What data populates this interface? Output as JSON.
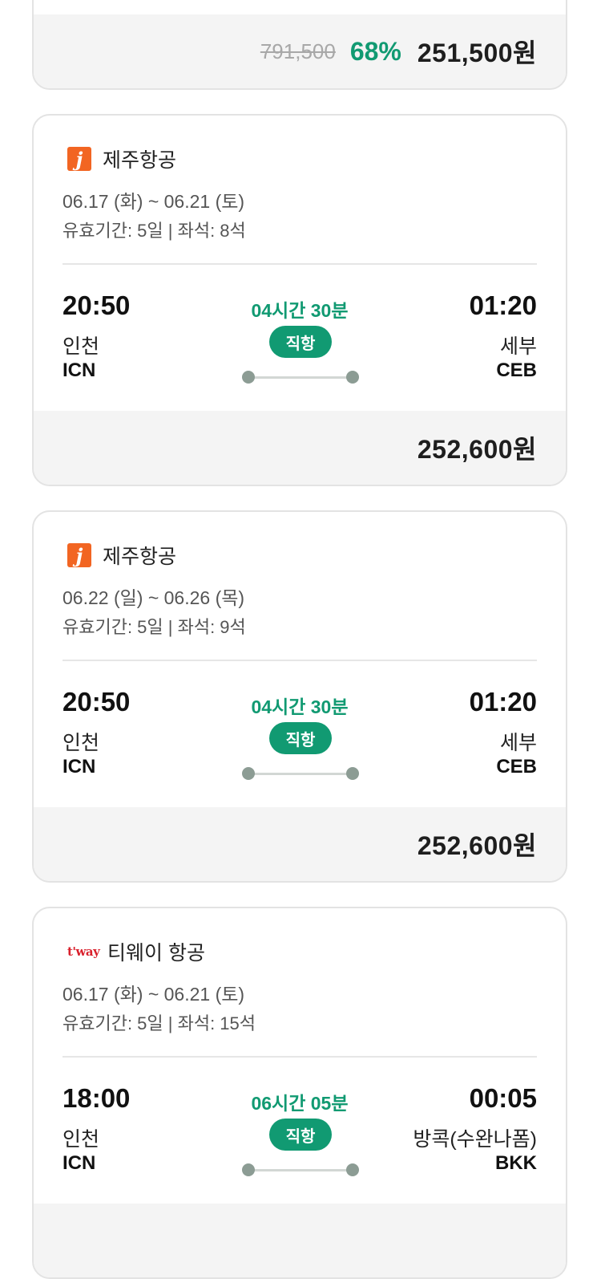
{
  "top_card": {
    "original_price": "791,500",
    "discount": "68%",
    "price": "251,500원"
  },
  "cards": [
    {
      "airline": "제주항공",
      "logo": "jeju-air-logo",
      "logo_text": "j",
      "dates": "06.17 (화) ~ 06.21 (토)",
      "meta": "유효기간: 5일 | 좌석: 8석",
      "dep_time": "20:50",
      "dep_city": "인천",
      "dep_code": "ICN",
      "duration": "04시간 30분",
      "badge": "직항",
      "arr_time": "01:20",
      "arr_city": "세부",
      "arr_code": "CEB",
      "price": "252,600원"
    },
    {
      "airline": "제주항공",
      "logo": "jeju-air-logo",
      "logo_text": "j",
      "dates": "06.22 (일) ~ 06.26 (목)",
      "meta": "유효기간: 5일 | 좌석: 9석",
      "dep_time": "20:50",
      "dep_city": "인천",
      "dep_code": "ICN",
      "duration": "04시간 30분",
      "badge": "직항",
      "arr_time": "01:20",
      "arr_city": "세부",
      "arr_code": "CEB",
      "price": "252,600원"
    },
    {
      "airline": "티웨이 항공",
      "logo": "tway-logo",
      "logo_text": "t'way",
      "dates": "06.17 (화) ~ 06.21 (토)",
      "meta": "유효기간: 5일 | 좌석: 15석",
      "dep_time": "18:00",
      "dep_city": "인천",
      "dep_code": "ICN",
      "duration": "06시간 05분",
      "badge": "직항",
      "arr_time": "00:05",
      "arr_city": "방콕(수완나폼)",
      "arr_code": "BKK"
    }
  ],
  "colors": {
    "accent": "#119a72",
    "jeju_brand": "#f26522",
    "tway_brand": "#d9202c",
    "price_bar_bg": "#f4f4f4"
  }
}
